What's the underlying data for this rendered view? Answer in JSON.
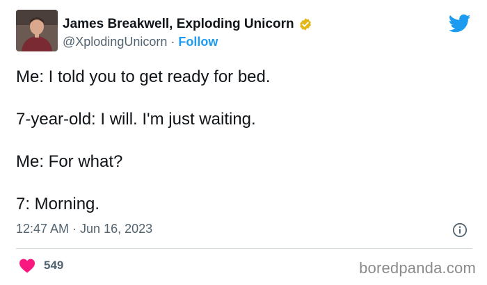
{
  "author": {
    "display_name": "James Breakwell, Exploding Unicorn",
    "handle": "@XplodingUnicorn",
    "separator": "·",
    "follow_label": "Follow",
    "verified": true,
    "verified_color": "#e2b719"
  },
  "tweet": {
    "lines": [
      "Me: I told you to get ready for bed.",
      "7-year-old: I will. I'm just waiting.",
      "Me: For what?",
      "7: Morning."
    ],
    "timestamp": "12:47 AM · Jun 16, 2023"
  },
  "actions": {
    "like_count": "549",
    "like_color": "#f91880"
  },
  "icons": {
    "logo": "twitter-bird-icon",
    "info": "info-icon",
    "like": "heart-icon",
    "verified": "verified-badge-icon"
  },
  "colors": {
    "brand": "#1d9bf0",
    "secondary_text": "#536471",
    "divider": "#cfd9de"
  },
  "watermark": "boredpanda.com"
}
